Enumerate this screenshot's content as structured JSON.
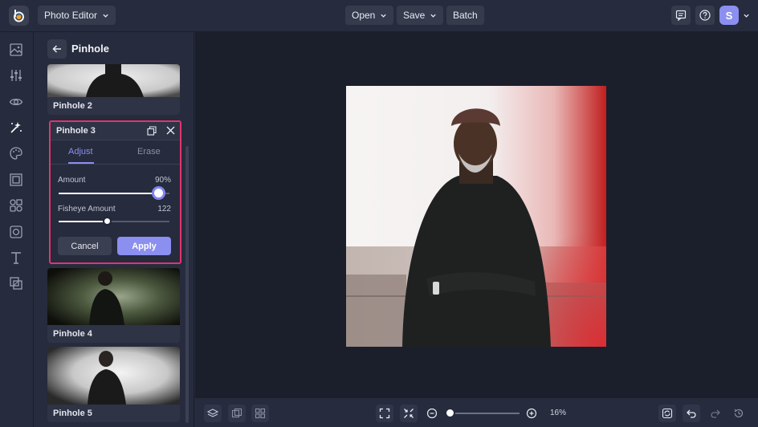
{
  "topbar": {
    "app_menu_label": "Photo Editor",
    "open_label": "Open",
    "save_label": "Save",
    "batch_label": "Batch",
    "avatar_letter": "S"
  },
  "rail": {
    "icons": [
      "image-icon",
      "sliders-icon",
      "eye-icon",
      "effects-icon",
      "paint-palette-icon",
      "frame-icon",
      "shapes-icon",
      "texture-icon",
      "text-icon",
      "overlay-icon"
    ]
  },
  "panel": {
    "title": "Pinhole",
    "cards": [
      {
        "label": "Pinhole 2"
      },
      {
        "label": "Pinhole 4"
      },
      {
        "label": "Pinhole 5"
      }
    ],
    "expanded": {
      "title": "Pinhole 3",
      "tabs": [
        "Adjust",
        "Erase"
      ],
      "active_tab": "Adjust",
      "amount_label": "Amount",
      "amount_value": "90%",
      "amount_fraction": 0.9,
      "fisheye_label": "Fisheye Amount",
      "fisheye_value": "122",
      "fisheye_fraction": 0.44,
      "cancel_label": "Cancel",
      "apply_label": "Apply"
    }
  },
  "bottombar": {
    "zoom_value": "16%",
    "zoom_fraction": 0.0
  },
  "colors": {
    "accent": "#8b8ff0",
    "highlight": "#e0356e",
    "background": "#262b3d",
    "canvas": "#1b1f2c"
  }
}
